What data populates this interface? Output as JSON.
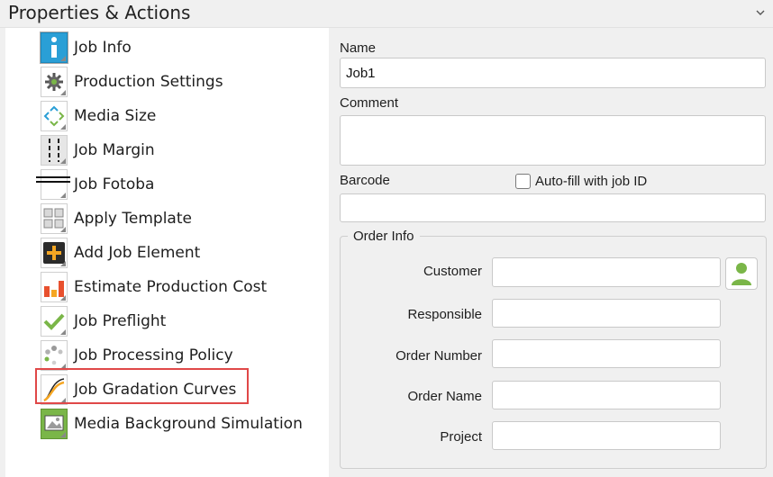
{
  "header": {
    "title": "Properties & Actions",
    "collapse_icon": "chevron-down-icon"
  },
  "sidebar": {
    "selected": "Job Info",
    "highlighted": "Job Gradation Curves",
    "items": [
      {
        "label": "Job Info",
        "icon": "info-icon"
      },
      {
        "label": "Production Settings",
        "icon": "gear-icon"
      },
      {
        "label": "Media Size",
        "icon": "media-size-icon"
      },
      {
        "label": "Job Margin",
        "icon": "margin-icon"
      },
      {
        "label": "Job Fotoba",
        "icon": "fotoba-icon"
      },
      {
        "label": "Apply Template",
        "icon": "template-grid-icon"
      },
      {
        "label": "Add Job Element",
        "icon": "add-element-icon"
      },
      {
        "label": "Estimate Production Cost",
        "icon": "bar-chart-icon"
      },
      {
        "label": "Job Preflight",
        "icon": "checkmark-icon"
      },
      {
        "label": "Job Processing Policy",
        "icon": "processing-dots-icon"
      },
      {
        "label": "Job Gradation Curves",
        "icon": "gradation-curve-icon"
      },
      {
        "label": "Media Background Simulation",
        "icon": "image-icon"
      }
    ]
  },
  "form": {
    "name_label": "Name",
    "name_value": "Job1",
    "comment_label": "Comment",
    "comment_value": "",
    "barcode_label": "Barcode",
    "barcode_value": "",
    "autofill_label": "Auto-fill with job ID",
    "autofill_checked": false
  },
  "order_info": {
    "title": "Order Info",
    "customer_label": "Customer",
    "customer_value": "",
    "customer_button_icon": "person-icon",
    "responsible_label": "Responsible",
    "responsible_value": "",
    "order_number_label": "Order Number",
    "order_number_value": "",
    "order_name_label": "Order Name",
    "order_name_value": "",
    "project_label": "Project",
    "project_value": ""
  },
  "colors": {
    "info_blue": "#2a9fd6",
    "accent_green": "#7ab648",
    "add_orange": "#f5a623",
    "highlight_red": "#e04848"
  }
}
